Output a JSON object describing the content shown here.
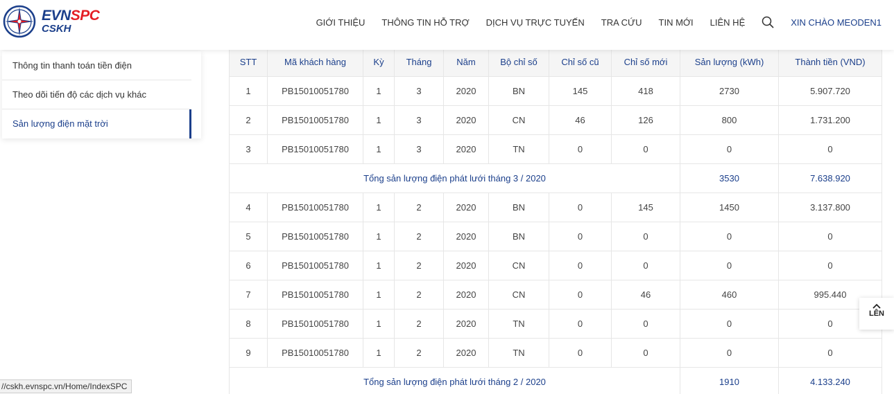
{
  "brand": {
    "line1a": "EVN",
    "line1b": "SPC",
    "line2": "CSKH",
    "colors": {
      "primary": "#1b3f8b",
      "accent": "#e41e25"
    }
  },
  "nav": {
    "items": [
      "GIỚI THIỆU",
      "THÔNG TIN HỖ TRỢ",
      "DỊCH VỤ TRỰC TUYẾN",
      "TRA CỨU",
      "TIN MỚI",
      "LIÊN HỆ"
    ],
    "search_icon": "search-icon",
    "user_greeting": "XIN CHÀO MEODEN1"
  },
  "sidebar": {
    "items": [
      {
        "label": "Thông tin thanh toán tiền điện",
        "active": false
      },
      {
        "label": "Theo dõi tiến độ các dịch vụ khác",
        "active": false
      },
      {
        "label": "Sản lượng điện mặt trời",
        "active": true
      }
    ]
  },
  "table": {
    "headers": [
      "STT",
      "Mã khách hàng",
      "Kỳ",
      "Tháng",
      "Năm",
      "Bộ chỉ số",
      "Chỉ số cũ",
      "Chỉ số mới",
      "Sản lượng (kWh)",
      "Thành tiền (VND)"
    ],
    "rows": [
      {
        "type": "data",
        "cells": [
          "1",
          "PB15010051780",
          "1",
          "3",
          "2020",
          "BN",
          "145",
          "418",
          "2730",
          "5.907.720"
        ]
      },
      {
        "type": "data",
        "cells": [
          "2",
          "PB15010051780",
          "1",
          "3",
          "2020",
          "CN",
          "46",
          "126",
          "800",
          "1.731.200"
        ]
      },
      {
        "type": "data",
        "cells": [
          "3",
          "PB15010051780",
          "1",
          "3",
          "2020",
          "TN",
          "0",
          "0",
          "0",
          "0"
        ]
      },
      {
        "type": "total",
        "label": "Tổng sản lượng điện phát lưới tháng 3 / 2020",
        "kwh": "3530",
        "amount": "7.638.920"
      },
      {
        "type": "data",
        "cells": [
          "4",
          "PB15010051780",
          "1",
          "2",
          "2020",
          "BN",
          "0",
          "145",
          "1450",
          "3.137.800"
        ]
      },
      {
        "type": "data",
        "cells": [
          "5",
          "PB15010051780",
          "1",
          "2",
          "2020",
          "BN",
          "0",
          "0",
          "0",
          "0"
        ]
      },
      {
        "type": "data",
        "cells": [
          "6",
          "PB15010051780",
          "1",
          "2",
          "2020",
          "CN",
          "0",
          "0",
          "0",
          "0"
        ]
      },
      {
        "type": "data",
        "cells": [
          "7",
          "PB15010051780",
          "1",
          "2",
          "2020",
          "CN",
          "0",
          "46",
          "460",
          "995.440"
        ]
      },
      {
        "type": "data",
        "cells": [
          "8",
          "PB15010051780",
          "1",
          "2",
          "2020",
          "TN",
          "0",
          "0",
          "0",
          "0"
        ]
      },
      {
        "type": "data",
        "cells": [
          "9",
          "PB15010051780",
          "1",
          "2",
          "2020",
          "TN",
          "0",
          "0",
          "0",
          "0"
        ]
      },
      {
        "type": "total",
        "label": "Tổng sản lượng điện phát lưới tháng 2 / 2020",
        "kwh": "1910",
        "amount": "4.133.240"
      }
    ]
  },
  "back_to_top": {
    "label": "LÊN",
    "icon": "chevron-up-icon"
  },
  "status_bar": {
    "url": "//cskh.evnspc.vn/Home/IndexSPC"
  }
}
